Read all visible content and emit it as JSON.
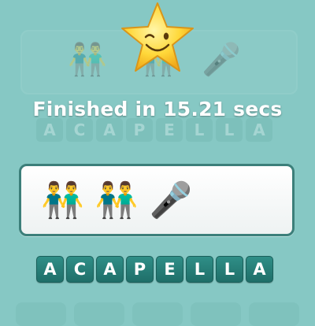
{
  "result": {
    "finished_text": "Finished in 15.21 secs"
  },
  "puzzle": {
    "emojis": [
      {
        "icon": "two-men-holding-hands-icon",
        "glyph": "👬"
      },
      {
        "icon": "two-men-holding-hands-icon",
        "glyph": "👬"
      },
      {
        "icon": "microphone-with-music-notes-icon",
        "glyph": "🎤"
      }
    ]
  },
  "answer": {
    "letters": [
      "A",
      "C",
      "A",
      "P",
      "E",
      "L",
      "L",
      "A"
    ]
  },
  "colors": {
    "background": "#86c8c4",
    "tile": "#2f8f87",
    "card_border": "#3c7f7a"
  }
}
